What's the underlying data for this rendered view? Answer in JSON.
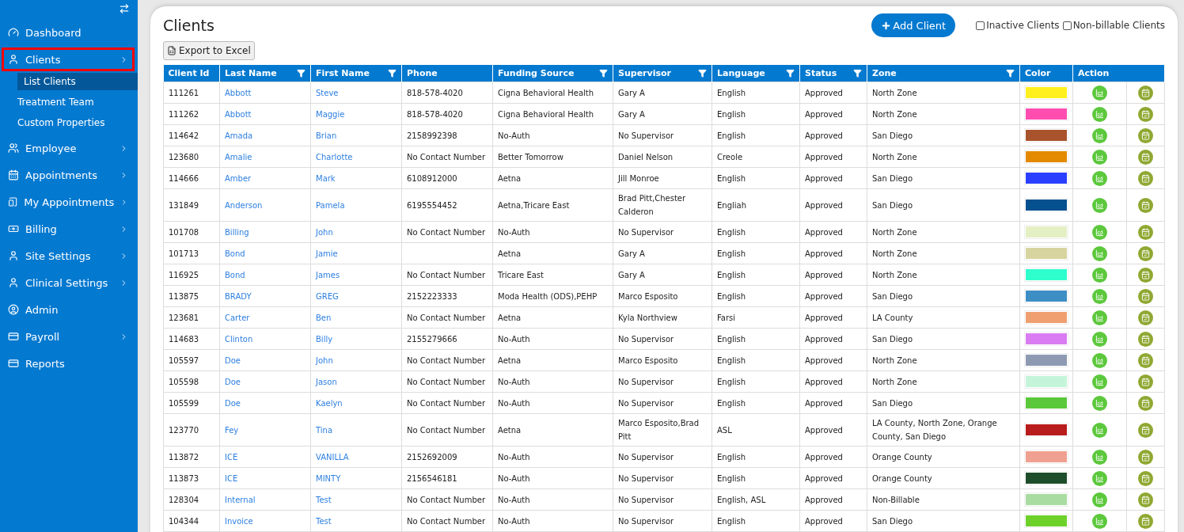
{
  "sidebar": {
    "items": [
      {
        "label": "Dashboard",
        "kind": "gauge",
        "submenu": false,
        "selected": false
      },
      {
        "label": "Clients",
        "kind": "user",
        "submenu": true,
        "selected": true,
        "children": [
          {
            "label": "List Clients",
            "selected": true
          },
          {
            "label": "Treatment Team",
            "selected": false
          },
          {
            "label": "Custom Properties",
            "selected": false
          }
        ]
      },
      {
        "label": "Employee",
        "kind": "users",
        "submenu": true,
        "selected": false
      },
      {
        "label": "Appointments",
        "kind": "calendar",
        "submenu": true,
        "selected": false
      },
      {
        "label": "My Appointments",
        "kind": "tablet",
        "submenu": true,
        "selected": false
      },
      {
        "label": "Billing",
        "kind": "money",
        "submenu": true,
        "selected": false
      },
      {
        "label": "Site Settings",
        "kind": "user",
        "submenu": true,
        "selected": false
      },
      {
        "label": "Clinical Settings",
        "kind": "user",
        "submenu": true,
        "selected": false
      },
      {
        "label": "Admin",
        "kind": "account",
        "submenu": false,
        "selected": false
      },
      {
        "label": "Payroll",
        "kind": "card",
        "submenu": true,
        "selected": false
      },
      {
        "label": "Reports",
        "kind": "card",
        "submenu": false,
        "selected": false
      }
    ]
  },
  "page": {
    "title": "Clients",
    "add_button": "Add Client",
    "export_button": "Export to Excel",
    "filters": [
      {
        "label": "Inactive Clients",
        "checked": false
      },
      {
        "label": "Non-billable Clients",
        "checked": false
      }
    ]
  },
  "table": {
    "columns": [
      {
        "label": "Client Id",
        "filter": false
      },
      {
        "label": "Last Name",
        "filter": true
      },
      {
        "label": "First Name",
        "filter": true
      },
      {
        "label": "Phone",
        "filter": false
      },
      {
        "label": "Funding Source",
        "filter": true
      },
      {
        "label": "Supervisor",
        "filter": true
      },
      {
        "label": "Language",
        "filter": true
      },
      {
        "label": "Status",
        "filter": true
      },
      {
        "label": "Zone",
        "filter": true
      },
      {
        "label": "Color",
        "filter": false
      },
      {
        "label": "Action",
        "filter": false
      }
    ],
    "rows": [
      {
        "client_id": "111261",
        "last_name": "Abbott",
        "first_name": "Steve",
        "phone": "818-578-4020",
        "funding": "Cigna Behavioral Health",
        "supervisor": "Gary A",
        "language": "English",
        "status": "Approved",
        "zone": "North Zone",
        "color": "#fff01e"
      },
      {
        "client_id": "111262",
        "last_name": "Abbott",
        "first_name": "Maggie",
        "phone": "818-578-4020",
        "funding": "Cigna Behavioral Health",
        "supervisor": "Gary A",
        "language": "English",
        "status": "Approved",
        "zone": "North Zone",
        "color": "#ff4db0"
      },
      {
        "client_id": "114642",
        "last_name": "Amada",
        "first_name": "Brian",
        "phone": "2158992398",
        "funding": "No-Auth",
        "supervisor": "No Supervisor",
        "language": "English",
        "status": "Approved",
        "zone": "San Diego",
        "color": "#a9532c"
      },
      {
        "client_id": "123680",
        "last_name": "Amalie",
        "first_name": "Charlotte",
        "phone": "No Contact Number",
        "funding": "Better Tomorrow",
        "supervisor": "Daniel Nelson",
        "language": "Creole",
        "status": "Approved",
        "zone": "North Zone",
        "color": "#e38a00"
      },
      {
        "client_id": "114666",
        "last_name": "Amber",
        "first_name": "Mark",
        "phone": "6108912000",
        "funding": "Aetna",
        "supervisor": "Jill Monroe",
        "language": "English",
        "status": "Approved",
        "zone": "San Diego",
        "color": "#2a3fff"
      },
      {
        "client_id": "131849",
        "last_name": "Anderson",
        "first_name": "Pamela",
        "phone": "6195554452",
        "funding": "Aetna,Tricare East",
        "supervisor": "Brad Pitt,Chester Calderon",
        "language": "Engliah",
        "status": "Approved",
        "zone": "San Diego",
        "color": "#05508f"
      },
      {
        "client_id": "101708",
        "last_name": "Billing",
        "first_name": "John",
        "phone": "No Contact Number",
        "funding": "No-Auth",
        "supervisor": "No Supervisor",
        "language": "English",
        "status": "Approved",
        "zone": "North Zone",
        "color": "#e4efc4"
      },
      {
        "client_id": "101713",
        "last_name": "Bond",
        "first_name": "Jamie",
        "funding": "Aetna",
        "supervisor": "Gary A",
        "language": "English",
        "status": "Approved",
        "zone": "North Zone",
        "color": "#d8d4a0"
      },
      {
        "client_id": "116925",
        "last_name": "Bond",
        "first_name": "James",
        "phone": "No Contact Number",
        "funding": "Tricare East",
        "supervisor": "Gary A",
        "language": "English",
        "status": "Approved",
        "zone": "North Zone",
        "color": "#2effcc"
      },
      {
        "client_id": "113875",
        "last_name": "BRADY",
        "first_name": "GREG",
        "phone": "2152223333",
        "funding": "Moda Health (ODS),PEHP",
        "supervisor": "Marco Esposito",
        "language": "English",
        "status": "Approved",
        "zone": "San Diego",
        "color": "#3d8ec4"
      },
      {
        "client_id": "123681",
        "last_name": "Carter",
        "first_name": "Ben",
        "phone": "No Contact Number",
        "funding": "Aetna",
        "supervisor": "Kyla Northview",
        "language": "Farsi",
        "status": "Approved",
        "zone": "LA County",
        "color": "#f0a070"
      },
      {
        "client_id": "114683",
        "last_name": "Clinton",
        "first_name": "Billy",
        "phone": "2155279666",
        "funding": "No-Auth",
        "supervisor": "No Supervisor",
        "language": "English",
        "status": "Approved",
        "zone": "San Diego",
        "color": "#d97cf2"
      },
      {
        "client_id": "105597",
        "last_name": "Doe",
        "first_name": "John",
        "phone": "No Contact Number",
        "funding": "Aetna",
        "supervisor": "Marco Esposito",
        "language": "English",
        "status": "Approved",
        "zone": "North Zone",
        "color": "#8e9ab2"
      },
      {
        "client_id": "105598",
        "last_name": "Doe",
        "first_name": "Jason",
        "phone": "No Contact Number",
        "funding": "No-Auth",
        "supervisor": "No Supervisor",
        "language": "English",
        "status": "Approved",
        "zone": "North Zone",
        "color": "#c4f5da"
      },
      {
        "client_id": "105599",
        "last_name": "Doe",
        "first_name": "Kaelyn",
        "phone": "No Contact Number",
        "funding": "No-Auth",
        "supervisor": "No Supervisor",
        "language": "English",
        "status": "Approved",
        "zone": "San Diego",
        "color": "#5ac83a"
      },
      {
        "client_id": "123770",
        "last_name": "Fey",
        "first_name": "Tina",
        "phone": "No Contact Number",
        "funding": "Aetna",
        "supervisor": "Marco Esposito,Brad Pitt",
        "language": "ASL",
        "status": "Approved",
        "zone": "LA County, North Zone, Orange County, San Diego",
        "color": "#b81c1c"
      },
      {
        "client_id": "113872",
        "last_name": "ICE",
        "first_name": "VANILLA",
        "phone": "2152692009",
        "funding": "No-Auth",
        "supervisor": "No Supervisor",
        "language": "English",
        "status": "Approved",
        "zone": "Orange County",
        "color": "#f0a090"
      },
      {
        "client_id": "113873",
        "last_name": "ICE",
        "first_name": "MINTY",
        "phone": "2156546181",
        "funding": "No-Auth",
        "supervisor": "No Supervisor",
        "language": "English",
        "status": "Approved",
        "zone": "Orange County",
        "color": "#1e4d2b"
      },
      {
        "client_id": "128304",
        "last_name": "Internal",
        "first_name": "Test",
        "phone": "No Contact Number",
        "funding": "No-Auth",
        "supervisor": "No Supervisor",
        "language": "English, ASL",
        "status": "Approved",
        "zone": "Non-Billable",
        "color": "#a8dca0"
      },
      {
        "client_id": "104344",
        "last_name": "Invoice",
        "first_name": "Test",
        "phone": "No Contact Number",
        "funding": "No-Auth",
        "supervisor": "No Supervisor",
        "language": "English",
        "status": "Approved",
        "zone": "San Diego",
        "color": "#6ed12a"
      }
    ]
  }
}
